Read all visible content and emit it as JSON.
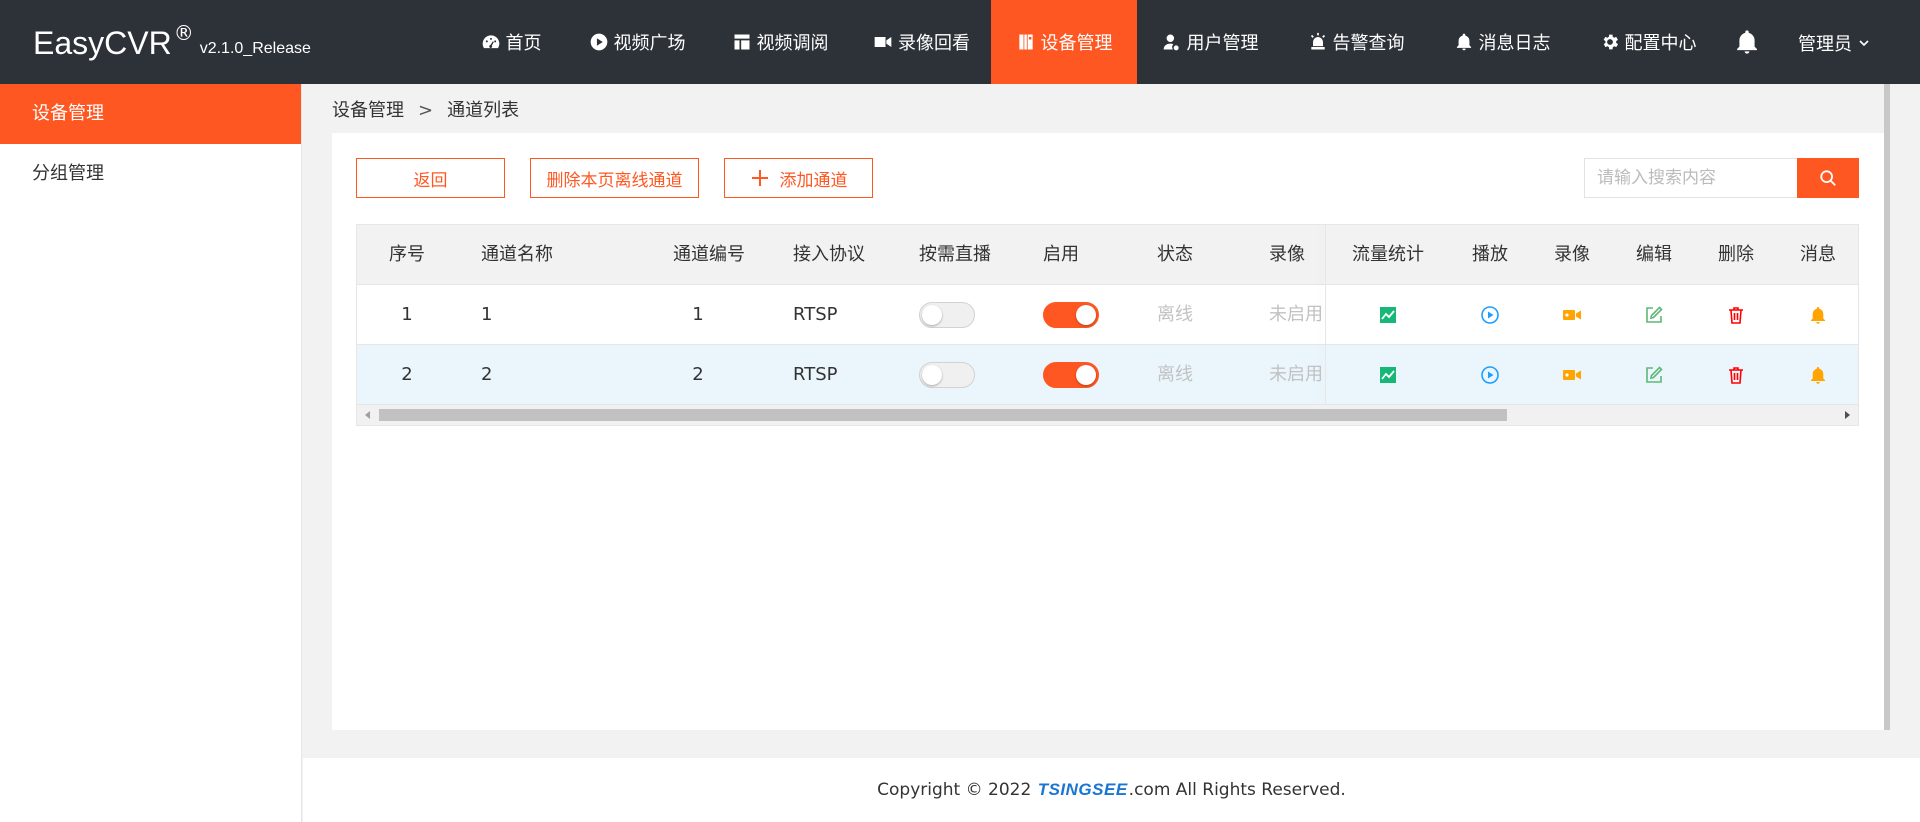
{
  "app": {
    "brand": "EasyCVR",
    "reg": "®",
    "version": "v2.1.0_Release"
  },
  "nav": [
    {
      "label": "首页",
      "icon": "dashboard-icon"
    },
    {
      "label": "视频广场",
      "icon": "play-circle-icon"
    },
    {
      "label": "视频调阅",
      "icon": "layout-icon"
    },
    {
      "label": "录像回看",
      "icon": "video-camera-icon"
    },
    {
      "label": "设备管理",
      "icon": "device-icon",
      "active": true
    },
    {
      "label": "用户管理",
      "icon": "user-icon"
    },
    {
      "label": "告警查询",
      "icon": "alarm-icon"
    },
    {
      "label": "消息日志",
      "icon": "bell-icon"
    },
    {
      "label": "配置中心",
      "icon": "gear-icon"
    }
  ],
  "user": {
    "name": "管理员"
  },
  "sidebar": {
    "items": [
      {
        "label": "设备管理",
        "active": true
      },
      {
        "label": "分组管理"
      }
    ]
  },
  "breadcrumb": {
    "parent": "设备管理",
    "separator": ">",
    "current": "通道列表"
  },
  "toolbar": {
    "back": "返回",
    "delete_offline": "删除本页离线通道",
    "add_channel": "添加通道"
  },
  "search": {
    "placeholder": "请输入搜索内容",
    "value": ""
  },
  "table": {
    "headers": {
      "index": "序号",
      "name": "通道名称",
      "number": "通道编号",
      "protocol": "接入协议",
      "on_demand": "按需直播",
      "enabled": "启用",
      "status": "状态",
      "record": "录像",
      "traffic": "流量统计",
      "play": "播放",
      "recording": "录像",
      "edit": "编辑",
      "delete": "删除",
      "message": "消息"
    },
    "rows": [
      {
        "index": "1",
        "name": "1",
        "number": "1",
        "protocol": "RTSP",
        "on_demand": false,
        "enabled": true,
        "status": "离线",
        "record": "未启用"
      },
      {
        "index": "2",
        "name": "2",
        "number": "2",
        "protocol": "RTSP",
        "on_demand": false,
        "enabled": true,
        "status": "离线",
        "record": "未启用"
      }
    ]
  },
  "colors": {
    "accent": "#ff5722",
    "topbar": "#2d3238",
    "traffic": "#16b777",
    "play": "#1e9fff",
    "record": "#ffa400",
    "edit": "#5fb878",
    "delete": "#ff0000",
    "message": "#ffa400"
  },
  "footer": {
    "prefix": "Copyright © 2022",
    "company": "TSINGSEE",
    "suffix": ".com All Rights Reserved."
  }
}
